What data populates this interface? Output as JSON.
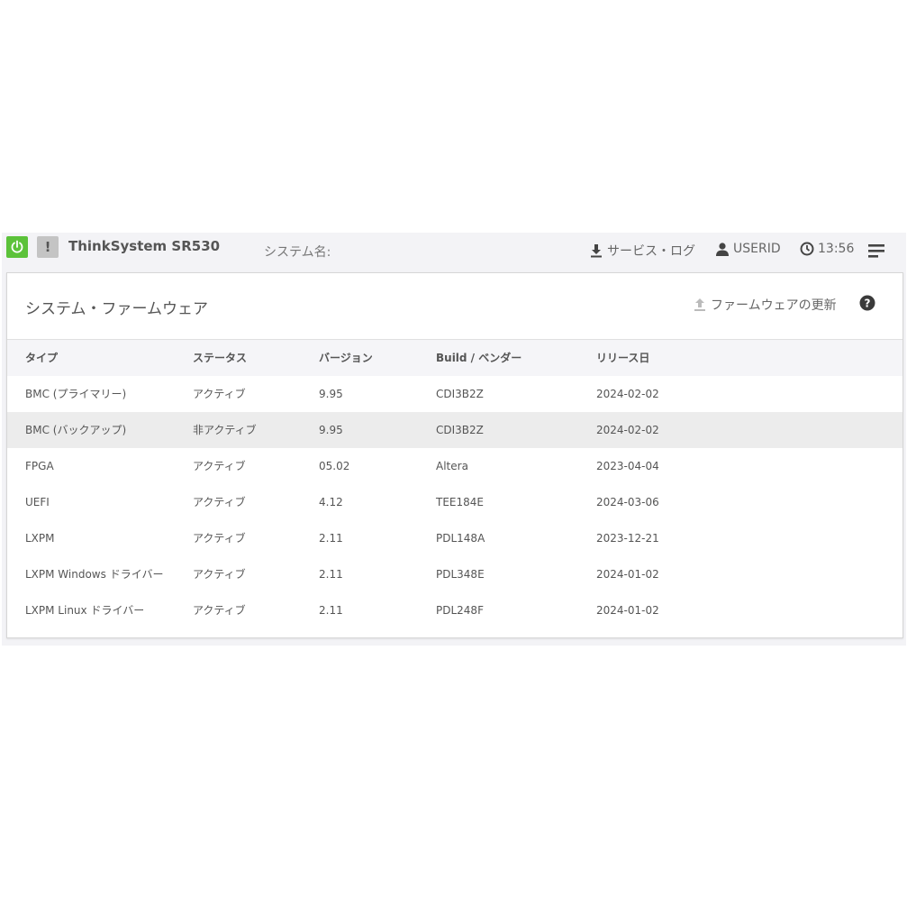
{
  "header": {
    "product": "ThinkSystem SR530",
    "system_name_label": "システム名:",
    "service_log": "サービス・ログ",
    "user": "USERID",
    "time": "13:56",
    "alert_glyph": "!"
  },
  "card": {
    "title": "システム・ファームウェア",
    "update_label": "ファームウェアの更新",
    "help_glyph": "?"
  },
  "table": {
    "headers": {
      "type": "タイプ",
      "status": "ステータス",
      "version": "バージョン",
      "build": "Build / ベンダー",
      "release": "リリース日"
    },
    "rows": [
      {
        "type": "BMC (プライマリー)",
        "status": "アクティブ",
        "version": "9.95",
        "build": "CDI3B2Z",
        "release": "2024-02-02"
      },
      {
        "type": "BMC (バックアップ)",
        "status": "非アクティブ",
        "version": "9.95",
        "build": "CDI3B2Z",
        "release": "2024-02-02"
      },
      {
        "type": "FPGA",
        "status": "アクティブ",
        "version": "05.02",
        "build": "Altera",
        "release": "2023-04-04"
      },
      {
        "type": "UEFI",
        "status": "アクティブ",
        "version": "4.12",
        "build": "TEE184E",
        "release": "2024-03-06"
      },
      {
        "type": "LXPM",
        "status": "アクティブ",
        "version": "2.11",
        "build": "PDL148A",
        "release": "2023-12-21"
      },
      {
        "type": "LXPM Windows ドライバー",
        "status": "アクティブ",
        "version": "2.11",
        "build": "PDL348E",
        "release": "2024-01-02"
      },
      {
        "type": "LXPM Linux ドライバー",
        "status": "アクティブ",
        "version": "2.11",
        "build": "PDL248F",
        "release": "2024-01-02"
      }
    ]
  },
  "colors": {
    "power_green": "#5cc23a",
    "selected_row": "#ececec",
    "topbar_bg": "#f3f3f6"
  }
}
